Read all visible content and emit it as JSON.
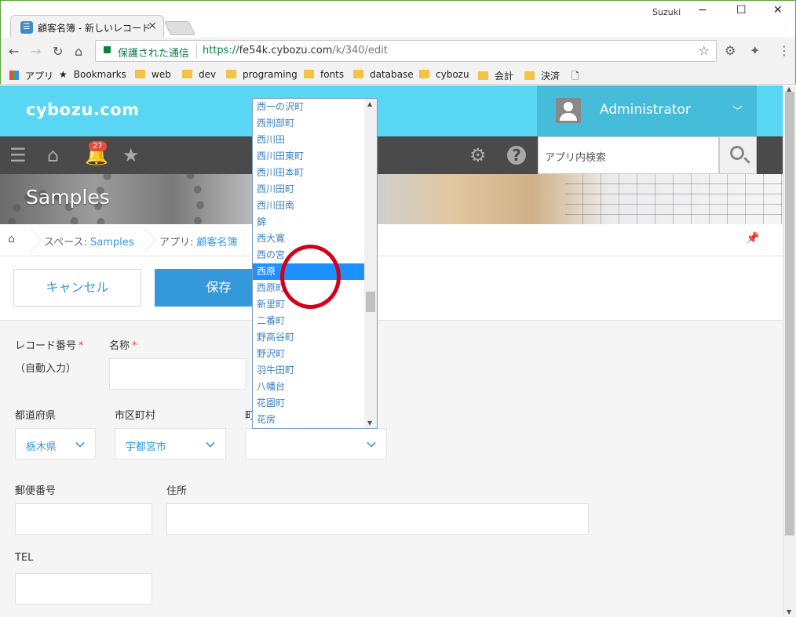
{
  "browser": {
    "tab_title": "顧客名簿 - 新しいレコード",
    "tab_close": "×",
    "user": "Suzuki",
    "win_min": "−",
    "win_max": "☐",
    "win_close": "✕",
    "secure_label": "保護された通信",
    "url_scheme": "https://",
    "url_host": "fe54k.cybozu.com",
    "url_path": "/k/340/edit",
    "bookmarks": [
      "アプリ",
      "Bookmarks",
      "web",
      "dev",
      "programing",
      "fonts",
      "database",
      "cybozu",
      "会計",
      "決済"
    ]
  },
  "app": {
    "logo": "cybozu.com",
    "user_name": "Administrator",
    "notification_count": "27",
    "search_placeholder": "アプリ内検索",
    "space_title": "Samples"
  },
  "breadcrumb": {
    "space_prefix": "スペース: ",
    "space_name": "Samples",
    "app_prefix": "アプリ: ",
    "app_name": "顧客名簿"
  },
  "actions": {
    "cancel_label": "キャンセル",
    "save_label": "保存"
  },
  "form": {
    "record_no_label": "レコード番号",
    "record_no_value": "（自動入力）",
    "name_label": "名称",
    "required_mark": "*",
    "prefecture_label": "都道府県",
    "prefecture_value": "栃木県",
    "city_label": "市区町村",
    "city_value": "宇都宮市",
    "town_label": "町",
    "postal_label": "郵便番号",
    "address_label": "住所",
    "tel_label": "TEL"
  },
  "dropdown": {
    "items": [
      "西一の沢町",
      "西刑部町",
      "西川田",
      "西川田東町",
      "西川田本町",
      "西川田町",
      "西川田南",
      "錦",
      "西大寛",
      "西の宮",
      "西原",
      "西原町",
      "新里町",
      "二番町",
      "野高谷町",
      "野沢町",
      "羽牛田町",
      "八幡台",
      "花園町",
      "花房"
    ],
    "highlighted_index": 10
  },
  "colors": {
    "header": "#58d6f4",
    "accent": "#3498db",
    "highlight": "#1e90ff",
    "annotation": "#d0021b"
  }
}
